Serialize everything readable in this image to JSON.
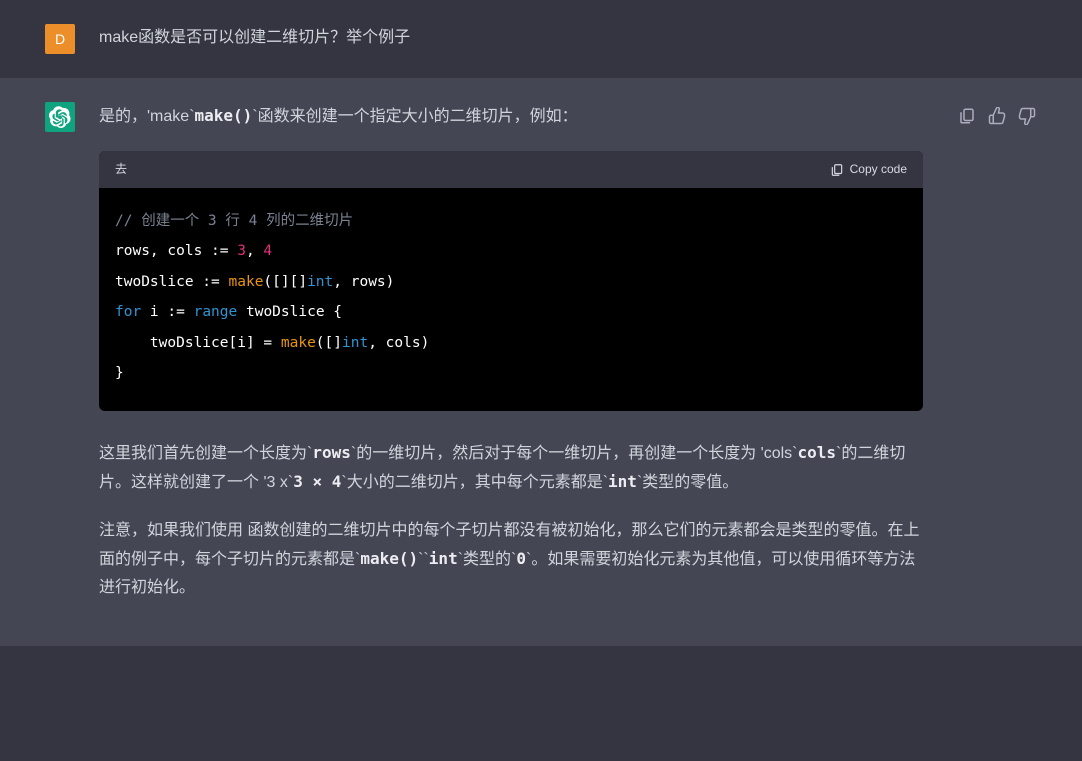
{
  "user": {
    "avatar_letter": "D",
    "message": "make函数是否可以创建二维切片？举个例子"
  },
  "assistant": {
    "intro_part1": "是的，'make",
    "intro_code1": "make()",
    "intro_part2": "函数来创建一个指定大小的二维切片，例如：",
    "code": {
      "lang_label": "去",
      "copy_label": "Copy code",
      "comment": "// 创建一个 3 行 4 列的二维切片",
      "line2_a": "rows, cols := ",
      "line2_n1": "3",
      "line2_sep": ", ",
      "line2_n2": "4",
      "line3_a": "twoDslice := ",
      "line3_fn": "make",
      "line3_b": "([][]",
      "line3_type": "int",
      "line3_c": ", rows)",
      "line4_kw": "for",
      "line4_a": " i := ",
      "line4_kw2": "range",
      "line4_b": " twoDslice {",
      "line5_a": "    twoDslice[i] = ",
      "line5_fn": "make",
      "line5_b": "([]",
      "line5_type": "int",
      "line5_c": ", cols)",
      "line6": "}"
    },
    "p2_a": "这里我们首先创建一个长度为",
    "p2_rows": "rows",
    "p2_b": "的一维切片，然后对于每个一维切片，再创建一个长度为 'cols",
    "p2_cols": "cols",
    "p2_c": "的二维切片。这样就创建了一个 '3 x",
    "p2_dim": "3 × 4",
    "p2_d": "大小的二维切片，其中每个元素都是",
    "p2_int": "int",
    "p2_e": "类型的零值。",
    "p3_a": "注意，如果我们使用 函数创建的二维切片中的每个子切片都没有被初始化，那么它们的元素都会是类型的零值。在上面的例子中，每个子切片的元素都是",
    "p3_make": "make()",
    "p3_int": "int",
    "p3_b": "类型的",
    "p3_zero": "0",
    "p3_c": "。如果需要初始化元素为其他值，可以使用循环等方法进行初始化。"
  }
}
